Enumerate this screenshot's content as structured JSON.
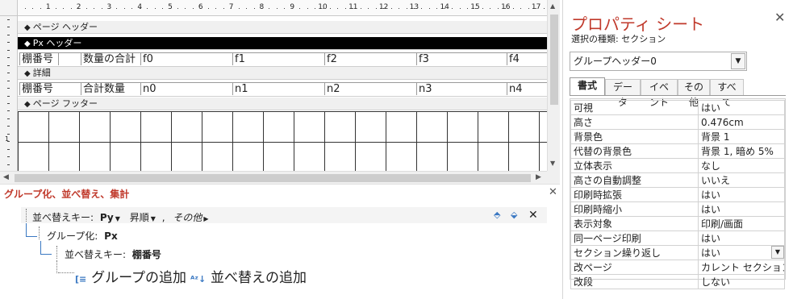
{
  "ruler": {
    "numbers": [
      "1",
      "2",
      "3",
      "4",
      "5",
      "6",
      "7",
      "8",
      "9",
      "10",
      "11",
      "12",
      "13",
      "14",
      "15",
      "16",
      "17"
    ]
  },
  "designer": {
    "sections": {
      "page_header": "ページ ヘッダー",
      "px_header": "Px ヘッダー",
      "detail": "詳細",
      "page_footer": "ページ フッター"
    },
    "header_row": [
      "棚番号",
      "数量の合計",
      "f0",
      "f1",
      "f2",
      "f3",
      "f4"
    ],
    "detail_row": [
      "棚番号",
      "合計数量",
      "n0",
      "n1",
      "n2",
      "n3",
      "n4"
    ]
  },
  "group_pane": {
    "title": "グループ化、並べ替え、集計",
    "sort_row": {
      "label": "並べ替えキー:",
      "field": "Py",
      "order": "昇順",
      "more": "その他"
    },
    "group_row": {
      "label": "グループ化:",
      "field": "Px"
    },
    "inner_sort_row": {
      "label": "並べ替えキー:",
      "field": "棚番号"
    },
    "add_group": "グループの追加",
    "add_sort": "並べ替えの追加"
  },
  "property_sheet": {
    "title": "プロパティ シート",
    "selection_type": "選択の種類: セクション",
    "selected_object": "グループヘッダー0",
    "tabs": [
      "書式",
      "データ",
      "イベント",
      "その他",
      "すべて"
    ],
    "active_tab": "書式",
    "properties": [
      {
        "name": "可視",
        "value": "はい"
      },
      {
        "name": "高さ",
        "value": "0.476cm"
      },
      {
        "name": "背景色",
        "value": "背景 1"
      },
      {
        "name": "代替の背景色",
        "value": "背景 1, 暗め 5%"
      },
      {
        "name": "立体表示",
        "value": "なし"
      },
      {
        "name": "高さの自動調整",
        "value": "いいえ"
      },
      {
        "name": "印刷時拡張",
        "value": "はい"
      },
      {
        "name": "印刷時縮小",
        "value": "はい"
      },
      {
        "name": "表示対象",
        "value": "印刷/画面"
      },
      {
        "name": "同一ページ印刷",
        "value": "はい"
      },
      {
        "name": "セクション繰り返し",
        "value": "はい"
      },
      {
        "name": "改ページ",
        "value": "カレント セクションの前"
      },
      {
        "name": "改段",
        "value": "しない"
      }
    ]
  },
  "colors": {
    "accent": "#c0392b",
    "selected_bar": "#000000",
    "connector": "#3a78c2"
  }
}
